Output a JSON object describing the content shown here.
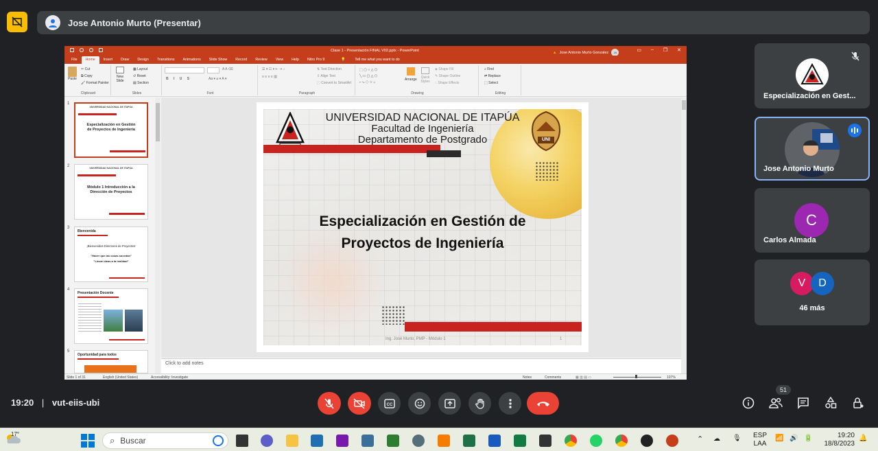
{
  "presenter_bar": {
    "name": "Jose Antonio Murto (Presentar)"
  },
  "powerpoint": {
    "document_title": "Clase 1 - Presentación FINAL V02.pptx  -  PowerPoint",
    "user": "Jose Antonio Murto Gonzalez",
    "user_initials": "JA",
    "tabs": [
      "File",
      "Home",
      "Insert",
      "Draw",
      "Design",
      "Transitions",
      "Animations",
      "Slide Show",
      "Record",
      "Review",
      "View",
      "Help",
      "Nitro Pro 9"
    ],
    "active_tab": "Home",
    "tell_me": "Tell me what you want to do",
    "ribbon": {
      "clipboard": {
        "paste": "Paste",
        "cut": "Cut",
        "copy": "Copy",
        "format_painter": "Format Painter",
        "name": "Clipboard"
      },
      "slides": {
        "new_slide": "New Slide",
        "layout": "Layout",
        "reset": "Reset",
        "section": "Section",
        "name": "Slides"
      },
      "font": {
        "name": "Font"
      },
      "paragraph": {
        "text_direction": "Text Direction",
        "align_text": "Align Text",
        "convert_smartart": "Convert to SmartArt",
        "name": "Paragraph"
      },
      "drawing": {
        "arrange": "Arrange",
        "quick_styles": "Quick Styles",
        "shape_fill": "Shape Fill",
        "shape_outline": "Shape Outline",
        "shape_effects": "Shape Effects",
        "name": "Drawing"
      },
      "editing": {
        "find": "Find",
        "replace": "Replace",
        "select": "Select",
        "name": "Editing"
      }
    },
    "thumbnails": [
      {
        "num": "1",
        "title": "Especialización en Gestión de Proyectos de Ingeniería",
        "header": "UNIVERSIDAD NACIONAL DE ITAPÚA"
      },
      {
        "num": "2",
        "title": "Módulo 1 Introducción a la Dirección de Proyectos",
        "header": "UNIVERSIDAD NACIONAL DE ITAPÚA"
      },
      {
        "num": "3",
        "heading": "Bienvenida",
        "line1": "¡Bienvenidos Directores de Proyectos!",
        "line2": "\"Hacer que las cosas sucedan\"",
        "line3": "\"Llevar ideas a la realidad\""
      },
      {
        "num": "4",
        "heading": "Presentación Docente"
      },
      {
        "num": "5",
        "heading": "Oportunidad para todos"
      }
    ],
    "slide": {
      "university": "UNIVERSIDAD NACIONAL DE ITAPÚA",
      "faculty": "Facultad de Ingeniería",
      "department": "Departamento de Postgrado",
      "title_line1": "Especialización en Gestión de",
      "title_line2": "Proyectos de Ingeniería",
      "footer": "Ing. José Murto, PMP - Módulo 1",
      "page": "1",
      "logo_right_text": "UNI"
    },
    "notes_placeholder": "Click to add notes",
    "status": {
      "slide_count": "Slide 1 of 31",
      "language": "English (United States)",
      "accessibility": "Accessibility: Investigate",
      "notes": "Notes",
      "comments": "Comments",
      "zoom": "107%"
    }
  },
  "participants": [
    {
      "name": "Especialización en Gest...",
      "muted": true
    },
    {
      "name": "Jose Antonio Murto",
      "speaking": true
    },
    {
      "name": "Carlos Almada",
      "initial": "C",
      "color": "#9c27b0"
    },
    {
      "label": "46 más",
      "initials": [
        "V",
        "D"
      ],
      "colors": [
        "#d81b60",
        "#1565c0"
      ]
    }
  ],
  "call": {
    "time": "19:20",
    "separator": "|",
    "meeting_code": "vut-eiis-ubi",
    "participant_count": "51"
  },
  "taskbar": {
    "weather": "17°",
    "search_placeholder": "Buscar",
    "lang1": "ESP",
    "lang2": "LAA",
    "clock_time": "19:20",
    "clock_date": "18/8/2023"
  }
}
